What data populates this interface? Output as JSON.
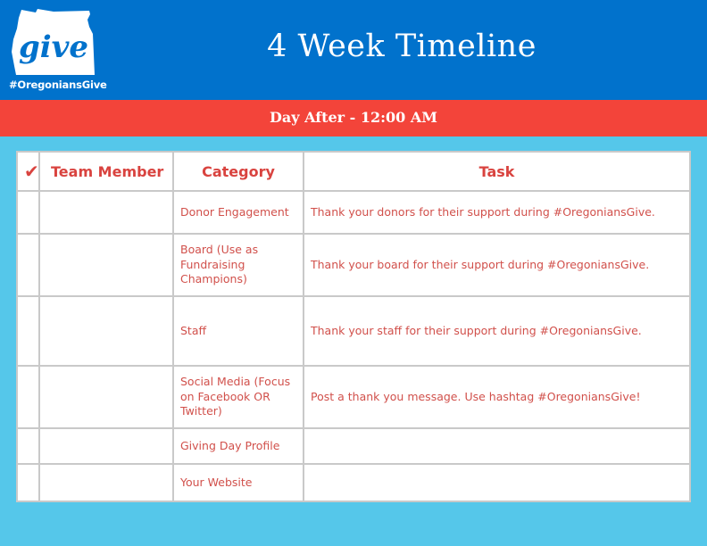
{
  "header": {
    "logo": {
      "icon": "oregon-state-give-logo",
      "word": "give",
      "hashtag": "#OregoniansGive"
    },
    "title": "4 Week Timeline",
    "subtitle": "Day After - 12:00 AM"
  },
  "colors": {
    "header_blue": "#0172CC",
    "band_red": "#F3443A",
    "page_bg": "#55C7EA",
    "text_red": "#D54B47",
    "grid": "#C9C9C9"
  },
  "table": {
    "columns": {
      "check": "✔",
      "member": "Team Member",
      "category": "Category",
      "task": "Task"
    },
    "rows": [
      {
        "check": "",
        "member": "",
        "category": "Donor Engagement",
        "task": "Thank your donors for their support during #OregoniansGive."
      },
      {
        "check": "",
        "member": "",
        "category": "Board (Use as Fundraising Champions)",
        "task": "Thank your board for their support during #OregoniansGive."
      },
      {
        "check": "",
        "member": "",
        "category": "Staff",
        "task": "Thank your staff for their support during #OregoniansGive."
      },
      {
        "check": "",
        "member": "",
        "category": "Social Media (Focus on Facebook OR Twitter)",
        "task": "Post a thank you message. Use hashtag #OregoniansGive!"
      },
      {
        "check": "",
        "member": "",
        "category": "Giving Day Profile",
        "task": ""
      },
      {
        "check": "",
        "member": "",
        "category": "Your Website",
        "task": ""
      }
    ]
  }
}
